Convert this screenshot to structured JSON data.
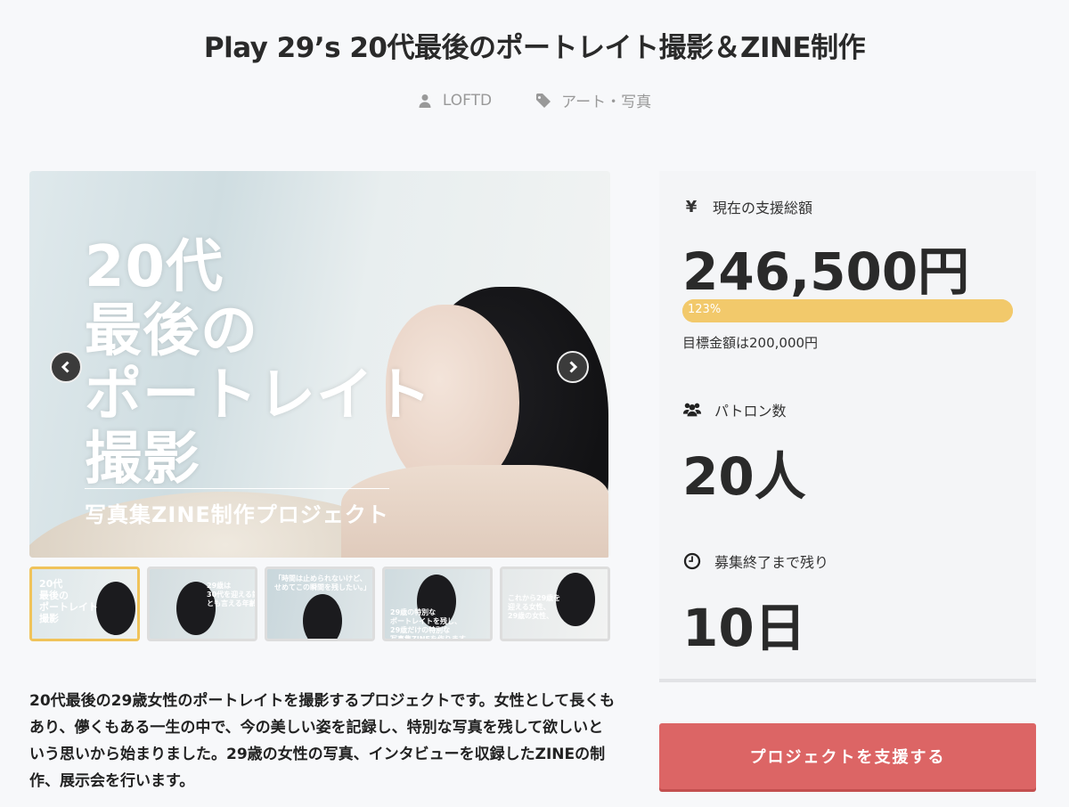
{
  "page": {
    "title": "Play 29’s 20代最後のポートレイト撮影＆ZINE制作"
  },
  "meta": {
    "author": "LOFTD",
    "category": "アート・写真"
  },
  "hero": {
    "title_lines": [
      "20代",
      "最後の",
      "ポートレイト",
      "撮影"
    ],
    "subtitle": "写真集ZINE制作プロジェクト"
  },
  "thumbnails": [
    {
      "text": "20代\n最後の\nポートレイト\n撮影"
    },
    {
      "text": "29歳は\n30代を迎える節目\nとも言える年齢。"
    },
    {
      "text": "「時間は止められないけど、\nせめてこの瞬間を残したい。」"
    },
    {
      "text": "29歳の特別な\nポートレイトを残し、\n29歳だけの特別な\n写真集ZINEを作ります。"
    },
    {
      "text": "これから29歳を\n迎える女性、\n29歳の女性、"
    }
  ],
  "stats": {
    "total_label": "現在の支援総額",
    "total_value": "246,500円",
    "progress_text": "123%",
    "progress_fraction": 1.0,
    "goal_text": "目標金額は200,000円",
    "patrons_label": "パトロン数",
    "patrons_value": "20人",
    "remaining_label": "募集終了まで残り",
    "remaining_value": "10日",
    "yen_symbol": "¥"
  },
  "description": "20代最後の29歳女性のポートレイトを撮影するプロジェクトです。女性として長くもあり、儚くもある一生の中で、今の美しい姿を記録し、特別な写真を残して欲しいという思いから始まりました。29歳の女性の写真、インタビューを収録したZINEの制作、展示会を行います。",
  "support_button": "プロジェクトを支援する",
  "colors": {
    "accent": "#dc6565",
    "progress": "#f2c96b",
    "active_thumb_border": "#f0c35a"
  }
}
